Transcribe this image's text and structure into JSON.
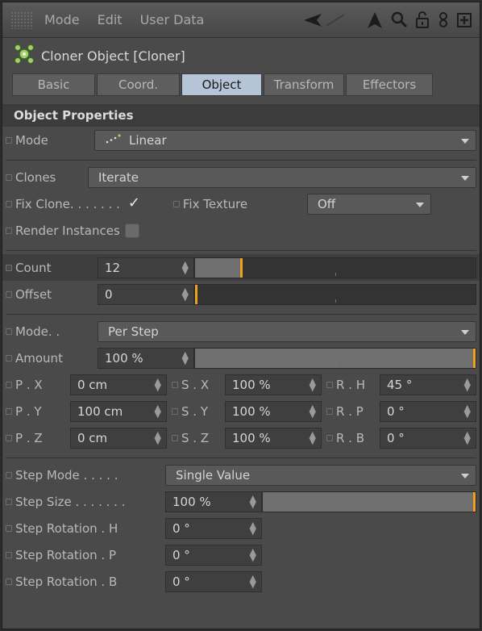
{
  "menubar": {
    "items": [
      "Mode",
      "Edit",
      "User Data"
    ]
  },
  "object": {
    "title": "Cloner Object [Cloner]"
  },
  "tabs": [
    {
      "label": "Basic"
    },
    {
      "label": "Coord."
    },
    {
      "label": "Object"
    },
    {
      "label": "Transform"
    },
    {
      "label": "Effectors"
    }
  ],
  "section": {
    "title": "Object Properties"
  },
  "mode": {
    "label": "Mode",
    "value": "Linear"
  },
  "clones": {
    "label": "Clones",
    "value": "Iterate"
  },
  "fix_clone": {
    "label": "Fix Clone. . . . . . .",
    "checked": true
  },
  "fix_texture": {
    "label": "Fix Texture",
    "value": "Off"
  },
  "render_instances": {
    "label": "Render Instances",
    "checked": false
  },
  "count": {
    "label": "Count",
    "value": "12",
    "slider": 0.16
  },
  "offset": {
    "label": "Offset",
    "value": "0",
    "slider": 0.0
  },
  "mode2": {
    "label": "Mode. .",
    "value": "Per Step"
  },
  "amount": {
    "label": "Amount",
    "value": "100 %",
    "slider": 1.0
  },
  "transform": {
    "px": {
      "label": "P . X",
      "value": "0 cm"
    },
    "py": {
      "label": "P . Y",
      "value": "100 cm"
    },
    "pz": {
      "label": "P . Z",
      "value": "0 cm"
    },
    "sx": {
      "label": "S . X",
      "value": "100 %"
    },
    "sy": {
      "label": "S . Y",
      "value": "100 %"
    },
    "sz": {
      "label": "S . Z",
      "value": "100 %"
    },
    "rh": {
      "label": "R . H",
      "value": "45 °"
    },
    "rp": {
      "label": "R . P",
      "value": "0 °"
    },
    "rb": {
      "label": "R . B",
      "value": "0 °"
    }
  },
  "step_mode": {
    "label": "Step Mode . . . . .",
    "value": "Single Value"
  },
  "step_size": {
    "label": "Step Size . . . . . . .",
    "value": "100 %",
    "slider": 1.0
  },
  "step_rot_h": {
    "label": "Step Rotation . H",
    "value": "0 °"
  },
  "step_rot_p": {
    "label": "Step Rotation . P",
    "value": "0 °"
  },
  "step_rot_b": {
    "label": "Step Rotation . B",
    "value": "0 °"
  },
  "colors": {
    "accent": "#f0a020",
    "active_tab": "#b5c4d6"
  }
}
